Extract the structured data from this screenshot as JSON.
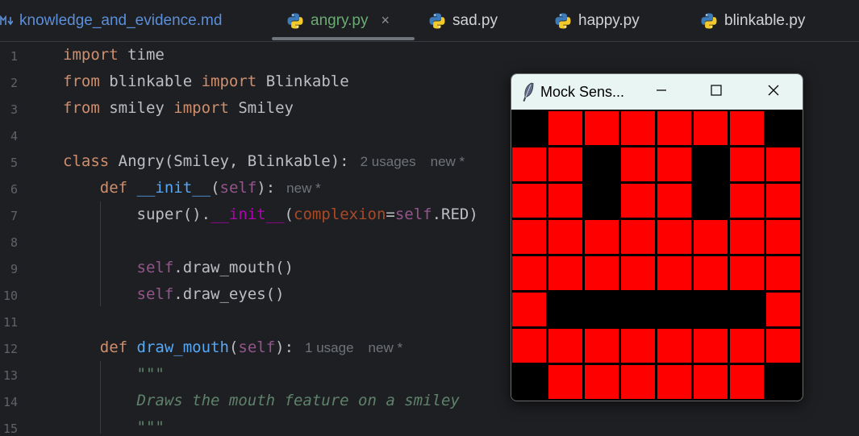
{
  "tabs": [
    {
      "label": "knowledge_and_evidence.md",
      "icon": "markdown-icon"
    },
    {
      "label": "angry.py",
      "icon": "python-icon",
      "active": true,
      "close": "×"
    },
    {
      "label": "sad.py",
      "icon": "python-icon"
    },
    {
      "label": "happy.py",
      "icon": "python-icon"
    },
    {
      "label": "blinkable.py",
      "icon": "python-icon"
    }
  ],
  "editor": {
    "line_numbers": [
      "1",
      "2",
      "3",
      "4",
      "5",
      "6",
      "7",
      "8",
      "9",
      "10",
      "11",
      "12",
      "13",
      "14",
      "15"
    ],
    "lines": [
      {
        "tokens": [
          {
            "t": "import",
            "c": "kw"
          },
          {
            "t": " time",
            "c": ""
          }
        ]
      },
      {
        "tokens": [
          {
            "t": "from",
            "c": "kw"
          },
          {
            "t": " blinkable ",
            "c": ""
          },
          {
            "t": "import",
            "c": "kw"
          },
          {
            "t": " Blinkable",
            "c": ""
          }
        ]
      },
      {
        "tokens": [
          {
            "t": "from",
            "c": "kw"
          },
          {
            "t": " smiley ",
            "c": ""
          },
          {
            "t": "import",
            "c": "kw"
          },
          {
            "t": " Smiley",
            "c": ""
          }
        ]
      },
      {
        "tokens": []
      },
      {
        "tokens": [
          {
            "t": "class",
            "c": "kw"
          },
          {
            "t": " Angry(Smiley, Blinkable):",
            "c": ""
          }
        ],
        "hints": [
          "2 usages",
          "new *"
        ]
      },
      {
        "tokens": [
          {
            "t": "    ",
            "c": ""
          },
          {
            "t": "def",
            "c": "kw"
          },
          {
            "t": " ",
            "c": ""
          },
          {
            "t": "__init__",
            "c": "fn"
          },
          {
            "t": "(",
            "c": ""
          },
          {
            "t": "self",
            "c": "slf"
          },
          {
            "t": "):",
            "c": ""
          }
        ],
        "hints": [
          "new *"
        ]
      },
      {
        "tokens": [
          {
            "t": "        super().",
            "c": ""
          },
          {
            "t": "__init__",
            "c": "dunder"
          },
          {
            "t": "(",
            "c": ""
          },
          {
            "t": "complexion",
            "c": "param"
          },
          {
            "t": "=",
            "c": ""
          },
          {
            "t": "self",
            "c": "slf"
          },
          {
            "t": ".RED)",
            "c": ""
          }
        ]
      },
      {
        "tokens": []
      },
      {
        "tokens": [
          {
            "t": "        ",
            "c": ""
          },
          {
            "t": "self",
            "c": "slf"
          },
          {
            "t": ".draw_mouth()",
            "c": ""
          }
        ]
      },
      {
        "tokens": [
          {
            "t": "        ",
            "c": ""
          },
          {
            "t": "self",
            "c": "slf"
          },
          {
            "t": ".draw_eyes()",
            "c": ""
          }
        ]
      },
      {
        "tokens": []
      },
      {
        "tokens": [
          {
            "t": "    ",
            "c": ""
          },
          {
            "t": "def",
            "c": "kw"
          },
          {
            "t": " ",
            "c": ""
          },
          {
            "t": "draw_mouth",
            "c": "fn"
          },
          {
            "t": "(",
            "c": ""
          },
          {
            "t": "self",
            "c": "slf"
          },
          {
            "t": "):",
            "c": ""
          }
        ],
        "hints": [
          "1 usage",
          "new *"
        ]
      },
      {
        "tokens": [
          {
            "t": "        \"\"\"",
            "c": "doc"
          }
        ]
      },
      {
        "tokens": [
          {
            "t": "        Draws the mouth feature on a smiley",
            "c": "doc"
          }
        ]
      },
      {
        "tokens": [
          {
            "t": "        \"\"\"",
            "c": "doc"
          }
        ]
      }
    ]
  },
  "mock_window": {
    "title": "Mock Sens...",
    "icon": "feather-icon",
    "controls": [
      "minimize-icon",
      "maximize-icon",
      "close-icon"
    ],
    "colors": {
      "on": "#ff0000",
      "off": "#000000"
    },
    "pixels": [
      [
        0,
        1,
        1,
        1,
        1,
        1,
        1,
        0
      ],
      [
        1,
        1,
        0,
        1,
        1,
        0,
        1,
        1
      ],
      [
        1,
        1,
        0,
        1,
        1,
        0,
        1,
        1
      ],
      [
        1,
        1,
        1,
        1,
        1,
        1,
        1,
        1
      ],
      [
        1,
        1,
        1,
        1,
        1,
        1,
        1,
        1
      ],
      [
        1,
        0,
        0,
        0,
        0,
        0,
        0,
        1
      ],
      [
        1,
        1,
        1,
        1,
        1,
        1,
        1,
        1
      ],
      [
        0,
        1,
        1,
        1,
        1,
        1,
        1,
        0
      ]
    ]
  }
}
